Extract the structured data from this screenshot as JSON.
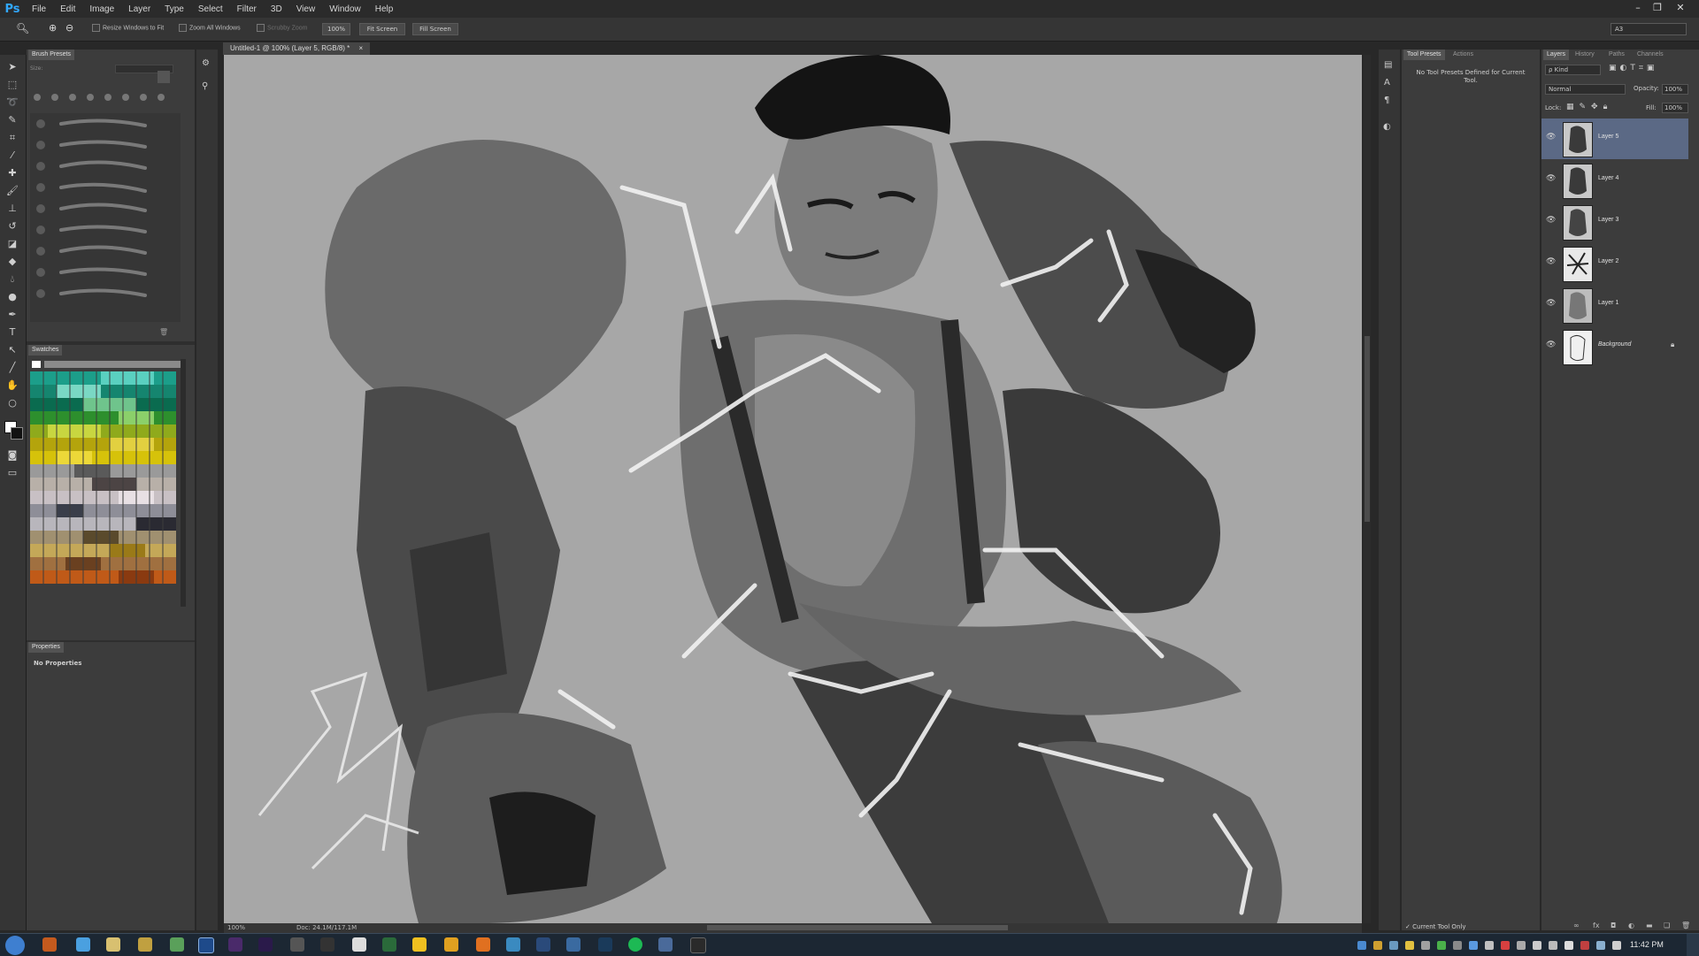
{
  "app": {
    "logo": "Ps"
  },
  "menu": [
    "File",
    "Edit",
    "Image",
    "Layer",
    "Type",
    "Select",
    "Filter",
    "3D",
    "View",
    "Window",
    "Help"
  ],
  "window_controls": [
    "–",
    "❐",
    "✕"
  ],
  "options_bar": {
    "resize_windows": "Resize Windows to Fit",
    "zoom_all": "Zoom All Windows",
    "scrubby_zoom": "Scrubby Zoom",
    "zoom_value": "100%",
    "fit_screen": "Fit Screen",
    "fill_screen": "Fill Screen",
    "workspace": "A3"
  },
  "brush_presets": {
    "tab": "Brush Presets",
    "size_label": "Size:"
  },
  "swatches": {
    "tab": "Swatches"
  },
  "properties": {
    "tab": "Properties",
    "content": "No Properties"
  },
  "document": {
    "tab": "Untitled-1 @ 100% (Layer 5, RGB/8) *",
    "close": "×",
    "zoom": "100%",
    "doc_size": "Doc: 24.1M/117.1M"
  },
  "tool_presets": {
    "tabs": [
      "Tool Presets",
      "Actions"
    ],
    "message": "No Tool Presets Defined for Current Tool.",
    "footer_check": "Current Tool Only"
  },
  "layers_panel": {
    "tabs": [
      "Layers",
      "History",
      "Paths",
      "Channels"
    ],
    "kind": "ρ Kind",
    "blend_mode": "Normal",
    "opacity_label": "Opacity:",
    "opacity": "100%",
    "lock_label": "Lock:",
    "fill_label": "Fill:",
    "fill": "100%",
    "layers": [
      {
        "name": "Layer 5",
        "selected": true
      },
      {
        "name": "Layer 4",
        "selected": false
      },
      {
        "name": "Layer 3",
        "selected": false
      },
      {
        "name": "Layer 2",
        "selected": false
      },
      {
        "name": "Layer 1",
        "selected": false
      },
      {
        "name": "Background",
        "selected": false
      }
    ]
  },
  "taskbar": {
    "clock": "11:42 PM"
  },
  "colors": {
    "accent": "#31a8ff",
    "selection": "#5b6985",
    "panel": "#3c3c3c",
    "canvas_bg": "#a8a8a8"
  }
}
